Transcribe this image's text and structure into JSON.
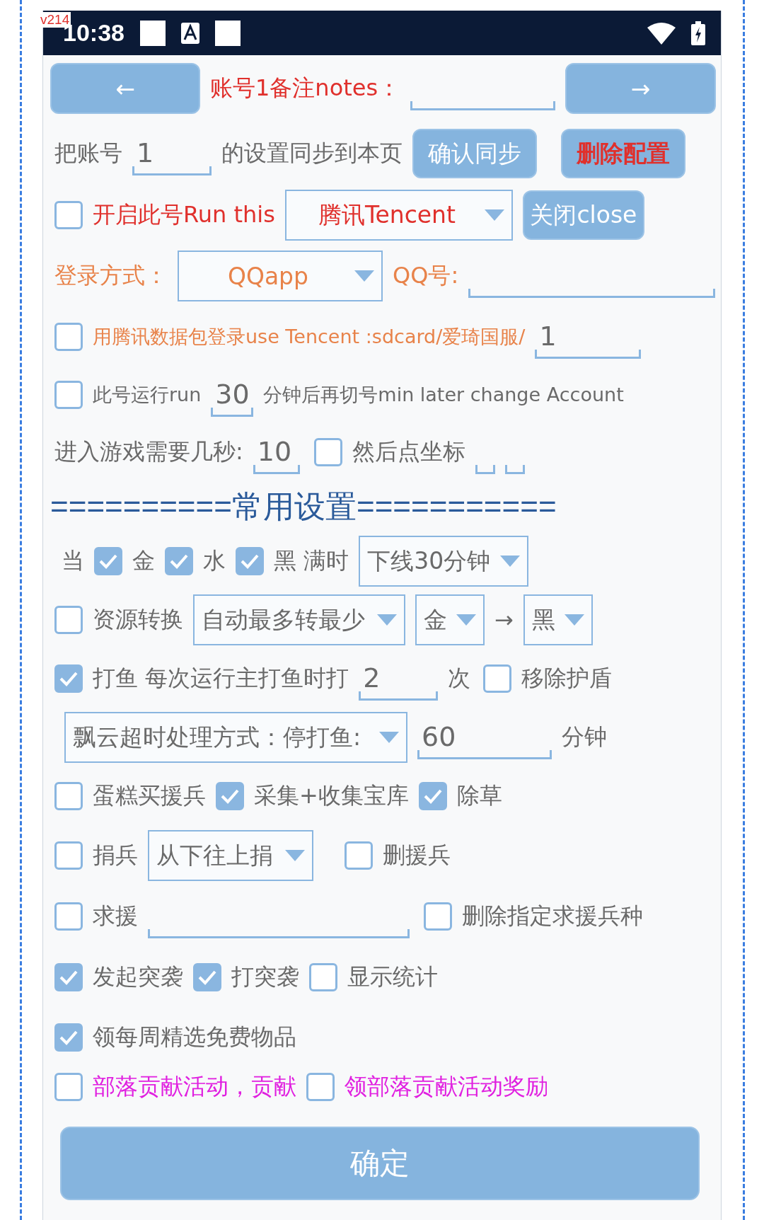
{
  "status_bar": {
    "badge": "v214",
    "time": "10:38"
  },
  "rows_top": [
    [
      {
        "kind": "button",
        "text": "←"
      },
      {
        "kind": "label",
        "text": "账号1备注notes：",
        "color": "#e0302c"
      },
      {
        "kind": "field"
      },
      {
        "kind": "button",
        "text": "→"
      }
    ],
    [
      {
        "kind": "label",
        "text": "把账号"
      },
      {
        "kind": "field",
        "value": "1"
      },
      {
        "kind": "label",
        "text": "的设置同步到本页"
      },
      {
        "kind": "button",
        "text": "确认同步"
      },
      {
        "kind": "button",
        "text": "删除配置",
        "color": "#e0302c"
      }
    ],
    [
      {
        "kind": "checkbox",
        "checked": false
      },
      {
        "kind": "label",
        "text": "开启此号Run this",
        "color": "#e0302c"
      },
      {
        "kind": "dropdown",
        "text": "腾讯Tencent",
        "color": "#e0302c"
      },
      {
        "kind": "button",
        "text": "关闭close"
      }
    ],
    [
      {
        "kind": "label",
        "text": "登录方式：",
        "color": "#e8834a"
      },
      {
        "kind": "dropdown",
        "text": "QQapp",
        "color": "#e8834a"
      },
      {
        "kind": "label",
        "text": "QQ号:",
        "color": "#e8834a"
      },
      {
        "kind": "field"
      }
    ],
    [
      {
        "kind": "checkbox",
        "checked": false
      },
      {
        "kind": "note",
        "text": "用腾讯数据包登录use Tencent :sdcard/爱琦国服/",
        "color": "#e8834a"
      },
      {
        "kind": "field",
        "value": "1"
      }
    ],
    [
      {
        "kind": "checkbox",
        "checked": false
      },
      {
        "kind": "note",
        "text": "此号运行run"
      },
      {
        "kind": "field",
        "value": "30"
      },
      {
        "kind": "note",
        "text": "分钟后再切号min later change Account"
      }
    ],
    [
      {
        "kind": "label",
        "text": "进入游戏需要几秒:"
      },
      {
        "kind": "field",
        "value": "10"
      },
      {
        "kind": "checkbox",
        "checked": false
      },
      {
        "kind": "label",
        "text": "然后点坐标"
      },
      {
        "kind": "field"
      },
      {
        "kind": "field"
      }
    ]
  ],
  "section_title": "==========常用设置===========",
  "rows": [
    [
      {
        "kind": "label",
        "text": "当"
      },
      {
        "kind": "checkbox",
        "checked": true
      },
      {
        "kind": "label",
        "text": "金"
      },
      {
        "kind": "checkbox",
        "checked": true
      },
      {
        "kind": "label",
        "text": "水"
      },
      {
        "kind": "checkbox",
        "checked": true
      },
      {
        "kind": "label",
        "text": "黑 满时"
      },
      {
        "kind": "dropdown",
        "text": "下线30分钟"
      }
    ],
    [
      {
        "kind": "checkbox",
        "checked": false
      },
      {
        "kind": "label",
        "text": "资源转换"
      },
      {
        "kind": "dropdown",
        "text": "自动最多转最少"
      },
      {
        "kind": "dropdown",
        "text": "金"
      },
      {
        "kind": "label",
        "text": "→"
      },
      {
        "kind": "dropdown",
        "text": "黑"
      }
    ],
    [
      {
        "kind": "checkbox",
        "checked": true
      },
      {
        "kind": "label",
        "text": "打鱼  每次运行主打鱼时打"
      },
      {
        "kind": "field",
        "value": "2"
      },
      {
        "kind": "label",
        "text": "次"
      },
      {
        "kind": "checkbox",
        "checked": false
      },
      {
        "kind": "label",
        "text": "移除护盾"
      }
    ],
    [
      {
        "kind": "dropdown",
        "text": "飘云超时处理方式：停打鱼:"
      },
      {
        "kind": "field",
        "value": "60"
      },
      {
        "kind": "label",
        "text": "分钟"
      }
    ],
    [
      {
        "kind": "checkbox",
        "checked": false
      },
      {
        "kind": "label",
        "text": "蛋糕买援兵"
      },
      {
        "kind": "checkbox",
        "checked": true
      },
      {
        "kind": "label",
        "text": "采集+收集宝库"
      },
      {
        "kind": "checkbox",
        "checked": true
      },
      {
        "kind": "label",
        "text": "除草"
      }
    ],
    [
      {
        "kind": "checkbox",
        "checked": false
      },
      {
        "kind": "label",
        "text": "捐兵"
      },
      {
        "kind": "dropdown",
        "text": "从下往上捐"
      },
      {
        "kind": "checkbox",
        "checked": false
      },
      {
        "kind": "label",
        "text": "删援兵"
      }
    ],
    [
      {
        "kind": "checkbox",
        "checked": false
      },
      {
        "kind": "label",
        "text": "求援"
      },
      {
        "kind": "field"
      },
      {
        "kind": "checkbox",
        "checked": false
      },
      {
        "kind": "label",
        "text": "删除指定求援兵种"
      }
    ],
    [
      {
        "kind": "checkbox",
        "checked": true
      },
      {
        "kind": "label",
        "text": "发起突袭"
      },
      {
        "kind": "checkbox",
        "checked": true
      },
      {
        "kind": "label",
        "text": "打突袭"
      },
      {
        "kind": "checkbox",
        "checked": false
      },
      {
        "kind": "label",
        "text": "显示统计"
      }
    ],
    [
      {
        "kind": "checkbox",
        "checked": true
      },
      {
        "kind": "label",
        "text": "领每周精选免费物品"
      }
    ],
    [
      {
        "kind": "checkbox",
        "checked": false
      },
      {
        "kind": "label",
        "text": "部落贡献活动，贡献",
        "color": "#e020e0"
      },
      {
        "kind": "checkbox",
        "checked": false
      },
      {
        "kind": "label",
        "text": "领部落贡献活动奖励",
        "color": "#e020e0"
      }
    ]
  ],
  "confirm_button": "确定"
}
